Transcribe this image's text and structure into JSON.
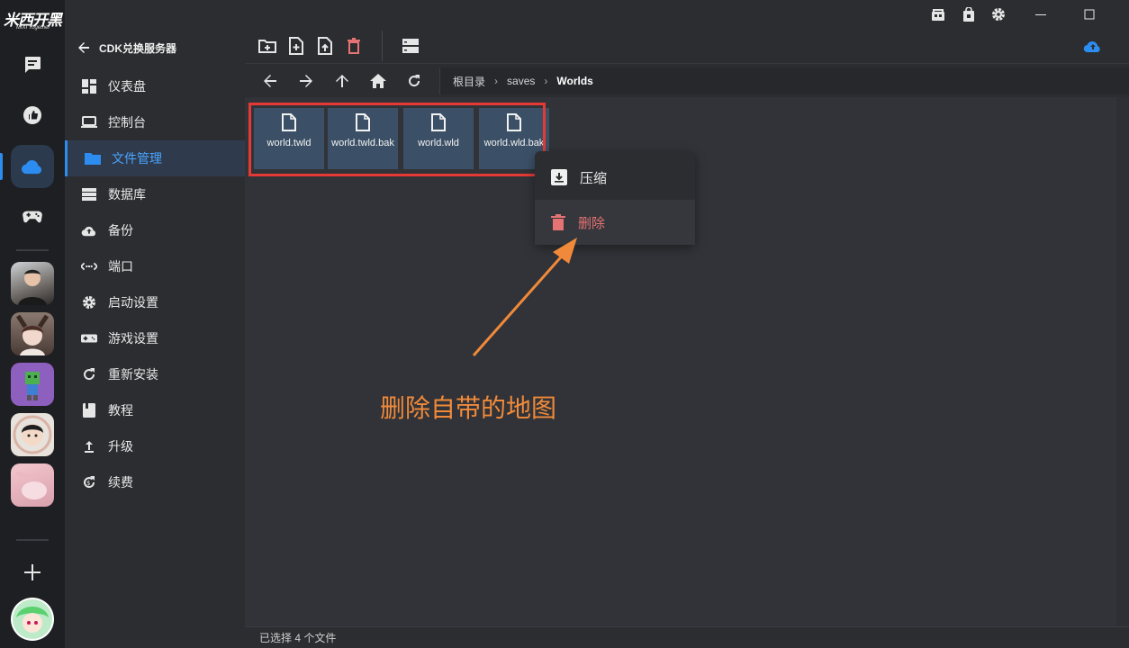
{
  "app": {
    "logo_text": "米西开黑",
    "logo_sub": "MIXI Together"
  },
  "sidebar": {
    "back_label": "CDK兑换服务器",
    "items": [
      {
        "label": "仪表盘"
      },
      {
        "label": "控制台"
      },
      {
        "label": "文件管理"
      },
      {
        "label": "数据库"
      },
      {
        "label": "备份"
      },
      {
        "label": "端口"
      },
      {
        "label": "启动设置"
      },
      {
        "label": "游戏设置"
      },
      {
        "label": "重新安装"
      },
      {
        "label": "教程"
      },
      {
        "label": "升级"
      },
      {
        "label": "续费"
      }
    ]
  },
  "breadcrumb": {
    "root": "根目录",
    "level1": "saves",
    "current": "Worlds"
  },
  "files": [
    {
      "name": "world.twld"
    },
    {
      "name": "world.twld.bak"
    },
    {
      "name": "world.wld"
    },
    {
      "name": "world.wld.bak"
    }
  ],
  "context_menu": {
    "compress": "压缩",
    "delete": "删除"
  },
  "annotation": "删除自带的地图",
  "status_text": "已选择 4 个文件",
  "colors": {
    "accent": "#2d8cf0",
    "danger": "#e57373",
    "annotation": "#f08a3a",
    "selection_box": "#e53935"
  }
}
